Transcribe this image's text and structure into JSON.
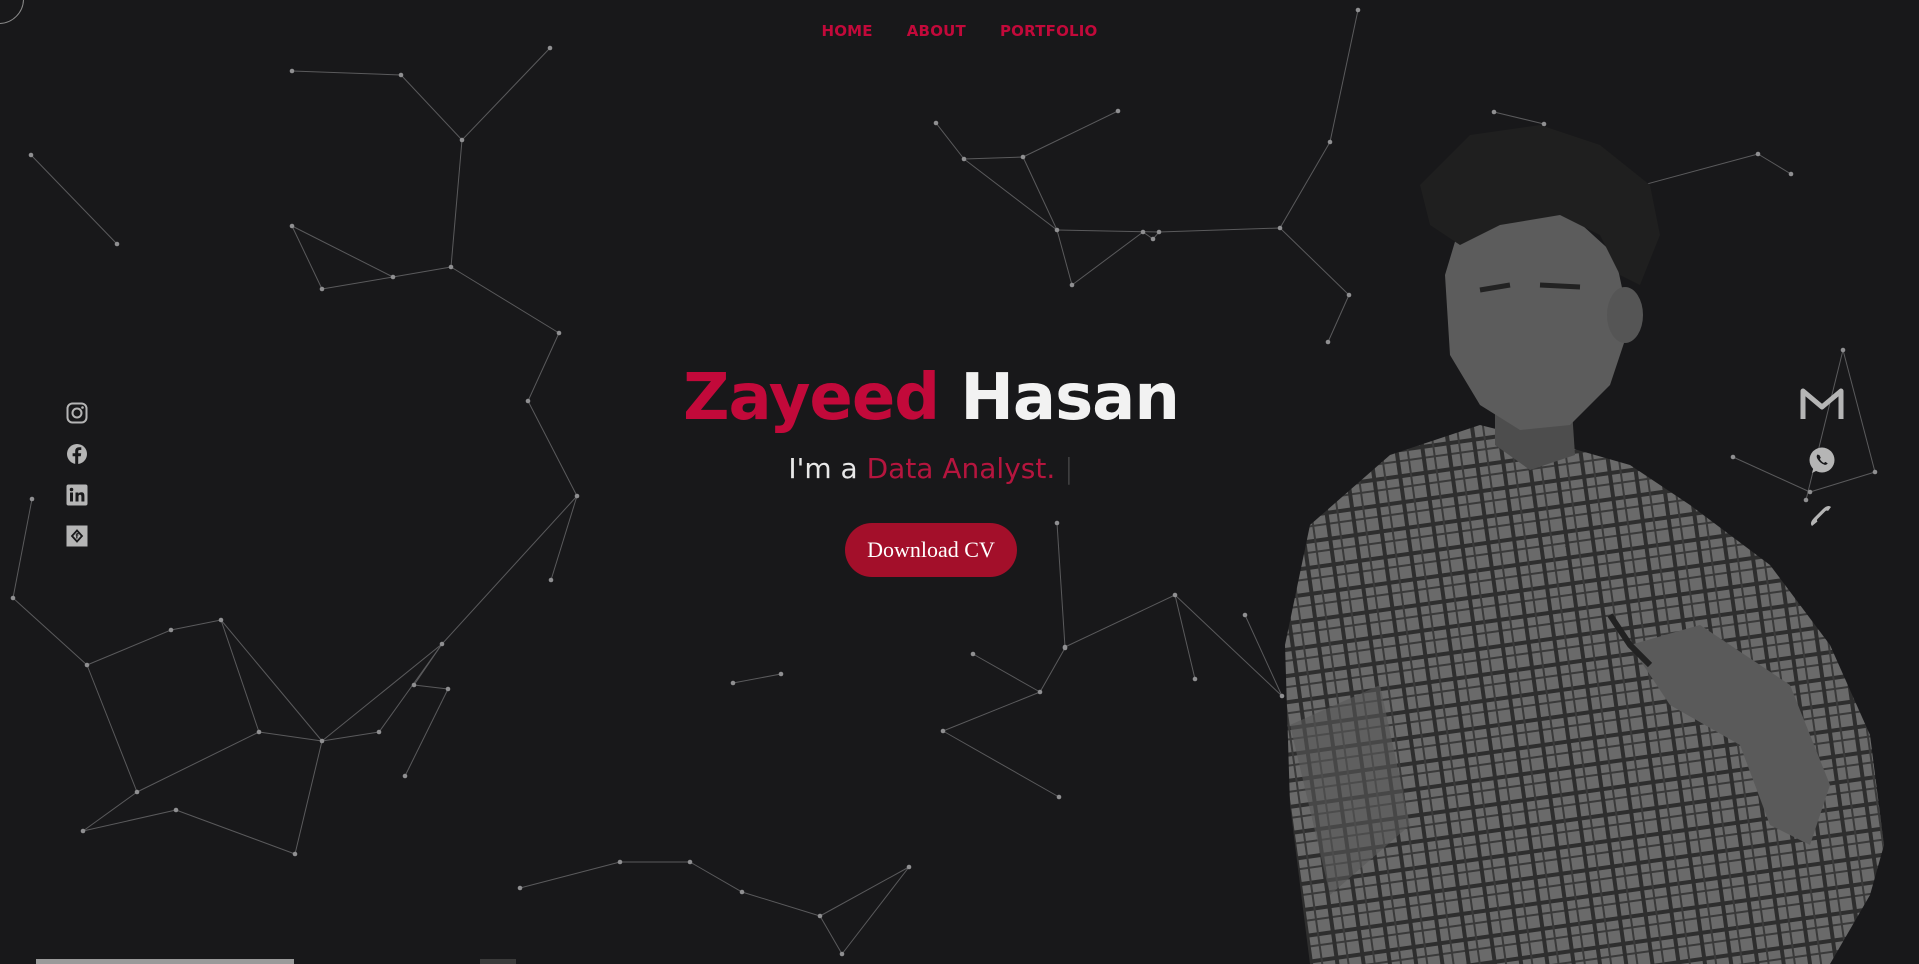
{
  "nav": {
    "items": [
      "HOME",
      "ABOUT",
      "PORTFOLIO"
    ]
  },
  "hero": {
    "first_name": "Zayeed",
    "last_name": "Hasan",
    "tagline_prefix": "I'm a ",
    "tagline_role": "Data Analyst.",
    "tagline_cursor": "|",
    "cta_label": "Download CV"
  },
  "social_icons": [
    "instagram-icon",
    "facebook-icon",
    "linkedin-icon",
    "fiverr-icon"
  ],
  "contact_icons": [
    "gmail-icon",
    "whatsapp-icon",
    "phone-icon"
  ],
  "colors": {
    "background": "#18181a",
    "accent": "#c2093a",
    "button": "#a30f2a",
    "text_light": "#f2f2f2",
    "icon_gray": "#b5b5b5"
  }
}
